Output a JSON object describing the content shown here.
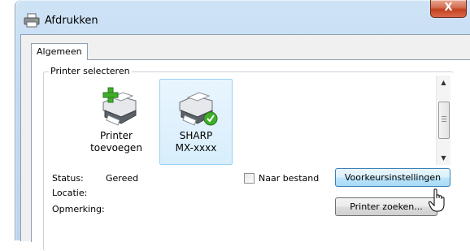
{
  "window": {
    "title": "Afdrukken",
    "close_glyph": "X"
  },
  "tabs": [
    {
      "label": "Algemeen",
      "selected": true
    }
  ],
  "printer_group": {
    "label": "Printer selecteren",
    "printers": [
      {
        "name": "Printer\ntoevoegen",
        "icon": "add-printer-icon",
        "selected": false
      },
      {
        "name": "SHARP\nMX-xxxx",
        "icon": "printer-default-icon",
        "selected": true
      }
    ]
  },
  "status": {
    "status_label": "Status:",
    "status_value": "Gereed",
    "location_label": "Locatie:",
    "location_value": "",
    "comment_label": "Opmerking:",
    "comment_value": ""
  },
  "print_to_file": {
    "label": "Naar bestand",
    "checked": false
  },
  "buttons": {
    "preferences": "Voorkeursinstellingen",
    "find_printer": "Printer zoeken..."
  },
  "colors": {
    "titlebar": "#c2daf1",
    "selected_item": "#d8eefc",
    "close_button": "#c2401f"
  }
}
